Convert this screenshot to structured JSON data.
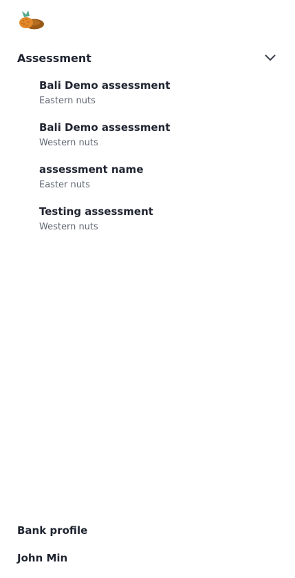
{
  "nav": {
    "section_title": "Assessment",
    "items": [
      {
        "title": "Bali Demo assessment",
        "subtitle": "Eastern nuts"
      },
      {
        "title": "Bali Demo assessment",
        "subtitle": "Western nuts"
      },
      {
        "title": "assessment name",
        "subtitle": "Easter nuts"
      },
      {
        "title": "Testing assessment",
        "subtitle": "Western nuts"
      }
    ],
    "bank_profile_label": "Bank profile",
    "user_name": "John Min"
  },
  "icons": {
    "logo": "nuts-logo-icon",
    "section_toggle": "chevron-down-icon"
  },
  "colors": {
    "text_primary": "#1f2430",
    "text_secondary": "#5f6672",
    "logo_orange": "#e2882a",
    "logo_brown": "#9a5a16",
    "logo_green": "#52a88a"
  }
}
